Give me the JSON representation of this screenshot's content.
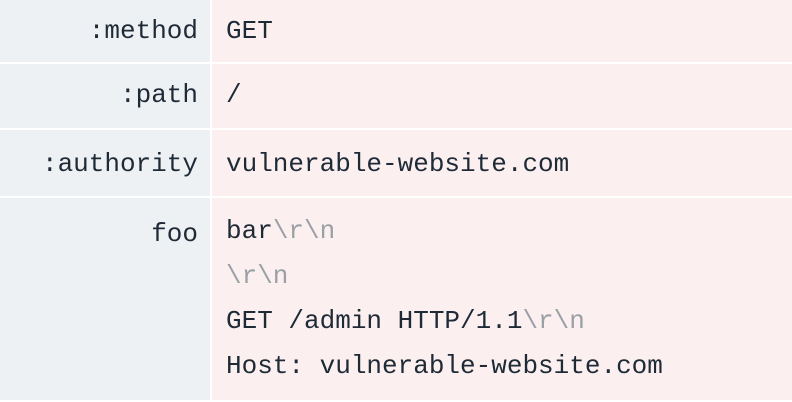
{
  "headers": [
    {
      "name": ":method",
      "value_lines": [
        [
          {
            "text": "GET",
            "escape": false
          }
        ]
      ]
    },
    {
      "name": ":path",
      "value_lines": [
        [
          {
            "text": "/",
            "escape": false
          }
        ]
      ]
    },
    {
      "name": ":authority",
      "value_lines": [
        [
          {
            "text": "vulnerable-website.com",
            "escape": false
          }
        ]
      ]
    },
    {
      "name": "foo",
      "value_lines": [
        [
          {
            "text": "bar",
            "escape": false
          },
          {
            "text": "\\r\\n",
            "escape": true
          }
        ],
        [
          {
            "text": "\\r\\n",
            "escape": true
          }
        ],
        [
          {
            "text": "GET /admin HTTP/1.1",
            "escape": false
          },
          {
            "text": "\\r\\n",
            "escape": true
          }
        ],
        [
          {
            "text": "Host: vulnerable-website.com",
            "escape": false
          }
        ]
      ]
    }
  ],
  "colors": {
    "key_bg": "#eef1f4",
    "value_bg": "#fbf0ef",
    "escape_text": "#9aa0a6",
    "text": "#1f2a37"
  }
}
